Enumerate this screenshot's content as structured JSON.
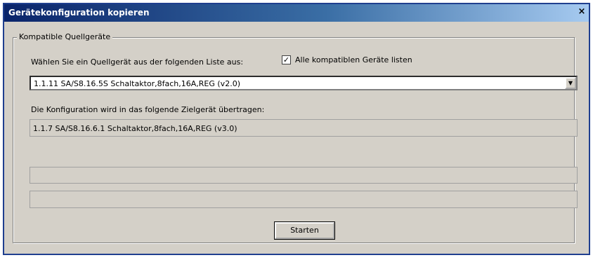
{
  "window": {
    "title": "Gerätekonfiguration kopieren",
    "close_glyph": "×"
  },
  "group": {
    "label": "Kompatible Quellgeräte",
    "instruction": "Wählen Sie ein Quellgerät aus der folgenden Liste aus:",
    "checkbox_label": "Alle kompatiblen Geräte listen",
    "checkbox_checked": true,
    "source_selected": "1.1.11 SA/S8.16.5S Schaltaktor,8fach,16A,REG (v2.0)",
    "target_info": "Die Konfiguration wird in das folgende Zielgerät übertragen:",
    "target_device": "1.1.7 SA/S8.16.6.1 Schaltaktor,8fach,16A,REG (v3.0)",
    "start_label": "Starten"
  }
}
